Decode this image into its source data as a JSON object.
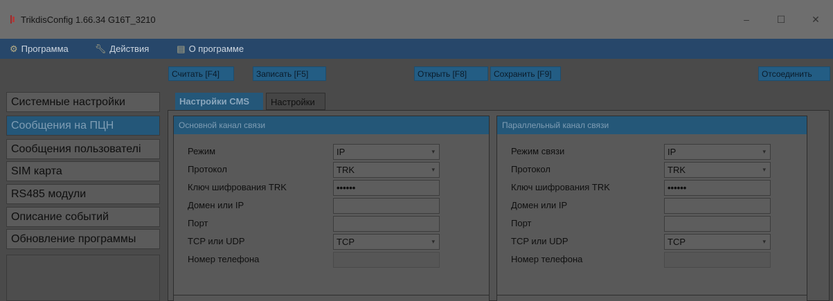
{
  "window": {
    "title": "TrikdisConfig 1.66.34   G16T_3210",
    "minimize": "–",
    "maximize": "☐",
    "close": "✕"
  },
  "menu": {
    "items": [
      {
        "label": "Программа",
        "icon": "gear-icon"
      },
      {
        "label": "Действия",
        "icon": "wrench-icon"
      },
      {
        "label": "О программе",
        "icon": "info-icon"
      }
    ]
  },
  "toolbar": {
    "read": "Считать [F4]",
    "write": "Записать [F5]",
    "open": "Открыть [F8]",
    "save": "Сохранить [F9]",
    "disconnect": "Отсоединить"
  },
  "sidebar": {
    "items": [
      {
        "label": "Системные настройки"
      },
      {
        "label": "Сообщения на ПЦН"
      },
      {
        "label": "Сообщения пользователі"
      },
      {
        "label": "SIM карта"
      },
      {
        "label": "RS485 модули"
      },
      {
        "label": "Описание событий"
      },
      {
        "label": "Обновление программы"
      }
    ],
    "active_index": 1
  },
  "tabs": [
    {
      "label": "Настройки CMS"
    },
    {
      "label": "Настройки"
    }
  ],
  "main_channel": {
    "title": "Основной канал связи",
    "rows": [
      {
        "label": "Режим",
        "value": "IP"
      },
      {
        "label": "Протокол",
        "value": "TRK"
      },
      {
        "label": "Ключ шифрования TRK",
        "value": "••••••"
      },
      {
        "label": "Домен или IP",
        "value": ""
      },
      {
        "label": "Порт",
        "value": ""
      },
      {
        "label": "TCP или UDP",
        "value": "TCP"
      },
      {
        "label": "Номер телефона",
        "value": ""
      }
    ]
  },
  "parallel_channel": {
    "title": "Параллельный канал связи",
    "rows": [
      {
        "label": "Режим связи",
        "value": "IP"
      },
      {
        "label": "Протокол",
        "value": "TRK"
      },
      {
        "label": "Ключ шифрования TRK",
        "value": "••••••"
      },
      {
        "label": "Домен или IP",
        "value": ""
      },
      {
        "label": "Порт",
        "value": ""
      },
      {
        "label": "TCP или UDP",
        "value": "TCP"
      },
      {
        "label": "Номер телефона",
        "value": ""
      }
    ]
  },
  "dropdown_chevron": "▾"
}
